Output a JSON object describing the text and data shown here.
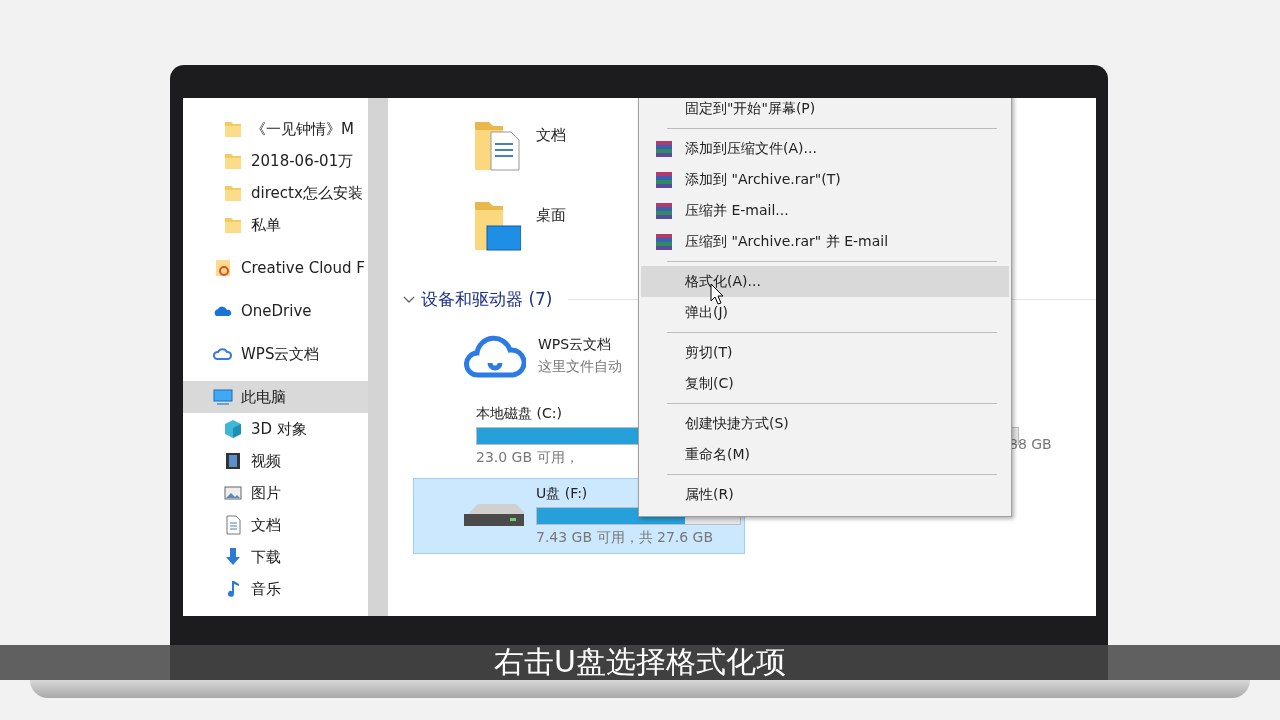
{
  "sidebar": {
    "items": [
      {
        "kind": "folder",
        "label": "《一见钟情》M"
      },
      {
        "kind": "folder",
        "label": "2018-06-01万"
      },
      {
        "kind": "folder",
        "label": "directx怎么安装"
      },
      {
        "kind": "folder",
        "label": "私单"
      },
      {
        "kind": "creative-cloud",
        "label": "Creative Cloud F"
      },
      {
        "kind": "onedrive",
        "label": "OneDrive"
      },
      {
        "kind": "wps",
        "label": "WPS云文档"
      },
      {
        "kind": "pc",
        "label": "此电脑",
        "selected": true,
        "children": [
          {
            "kind": "objects",
            "label": "3D 对象",
            "selected": false
          },
          {
            "kind": "video",
            "label": "视频",
            "selected": false
          },
          {
            "kind": "pictures",
            "label": "图片",
            "selected": false
          },
          {
            "kind": "documents",
            "label": "文档",
            "selected": false
          },
          {
            "kind": "downloads",
            "label": "下载",
            "selected": false
          },
          {
            "kind": "music",
            "label": "音乐",
            "selected": false
          }
        ]
      }
    ]
  },
  "folders": [
    {
      "kind": "documents",
      "name": "文档"
    },
    {
      "kind": "desktop",
      "name": "桌面"
    }
  ],
  "devices": {
    "title": "设备和驱动器 (7)",
    "expanded": true,
    "items": [
      {
        "kind": "cloud",
        "name": "WPS云文档",
        "subtitle": "这里文件自动",
        "selected": false
      },
      {
        "kind": "system-drive",
        "name": "本地磁盘 (C:)",
        "level": 0.85,
        "free": "23.0 GB 可用，",
        "total": "88 GB",
        "selected": false
      },
      {
        "kind": "drive",
        "name": "U盘 (F:)",
        "level": 0.73,
        "free": "7.43 GB 可用，共 27.6 GB",
        "selected": true
      }
    ]
  },
  "context_menu": [
    {
      "kind": "item",
      "label": "固定到\"开始\"屏幕(P)",
      "hovered": false
    },
    {
      "kind": "separator"
    },
    {
      "kind": "rar",
      "label": "添加到压缩文件(A)...",
      "hovered": false
    },
    {
      "kind": "rar",
      "label": "添加到 \"Archive.rar\"(T)",
      "hovered": false
    },
    {
      "kind": "rar",
      "label": "压缩并 E-mail...",
      "hovered": false
    },
    {
      "kind": "rar",
      "label": "压缩到 \"Archive.rar\" 并 E-mail",
      "hovered": false
    },
    {
      "kind": "separator"
    },
    {
      "kind": "item",
      "label": "格式化(A)...",
      "hovered": true
    },
    {
      "kind": "item",
      "label": "弹出(J)",
      "hovered": false
    },
    {
      "kind": "separator"
    },
    {
      "kind": "item",
      "label": "剪切(T)",
      "hovered": false
    },
    {
      "kind": "item",
      "label": "复制(C)",
      "hovered": false
    },
    {
      "kind": "separator"
    },
    {
      "kind": "item",
      "label": "创建快捷方式(S)",
      "hovered": false
    },
    {
      "kind": "item",
      "label": "重命名(M)",
      "hovered": false
    },
    {
      "kind": "separator"
    },
    {
      "kind": "item",
      "label": "属性(R)",
      "hovered": false
    }
  ],
  "subtitle": "右击U盘选择格式化项"
}
